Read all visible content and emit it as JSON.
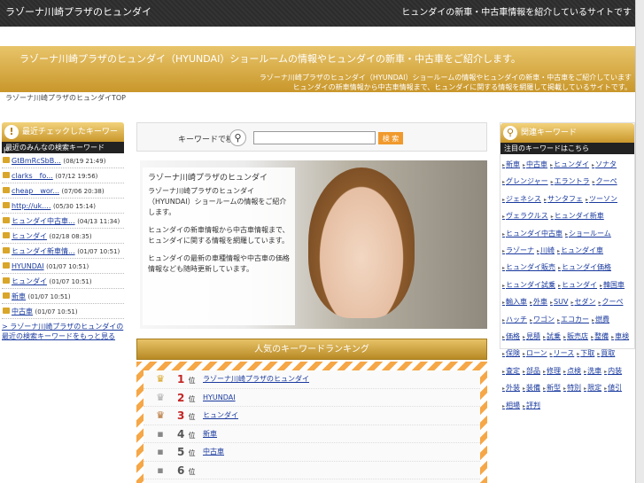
{
  "header": {
    "site_title": "ラゾーナ川崎プラザのヒュンダイ",
    "right_text": "ヒュンダイの新車・中古車情報を紹介しているサイトです"
  },
  "banner": {
    "title": "ラゾーナ川崎プラザのヒュンダイ（HYUNDAI）ショールームの情報やヒュンダイの新車・中古車をご紹介します。",
    "desc_line1": "ラゾーナ川崎プラザのヒュンダイ（HYUNDAI）ショールームの情報やヒュンダイの新車・中古車をご紹介しています",
    "desc_line2": "ヒュンダイの新車情報から中古車情報まで、ヒュンダイに関する情報を網羅して掲載しているサイトです。"
  },
  "breadcrumb": "ラゾーナ川崎プラザのヒュンダイTOP",
  "left": {
    "header": "最近チェックしたキーワード",
    "sub": "最近のみんなの検索キーワード",
    "items": [
      {
        "text": "GtBmRcSbB...",
        "date": "(08/19 21:49)"
      },
      {
        "text": "clarks　fo...",
        "date": "(07/12 19:56)"
      },
      {
        "text": "cheap　wor...",
        "date": "(07/06 20:38)"
      },
      {
        "text": "http://uk....",
        "date": "(05/30 15:14)"
      },
      {
        "text": "ヒュンダイ中古車...",
        "date": "(04/13 11:34)"
      },
      {
        "text": "ヒュンダイ",
        "date": "(02/18 08:35)"
      },
      {
        "text": "ヒュンダイ新車情...",
        "date": "(01/07 10:51)"
      },
      {
        "text": "HYUNDAI",
        "date": "(01/07 10:51)"
      },
      {
        "text": "ヒュンダイ",
        "date": "(01/07 10:51)"
      },
      {
        "text": "新車",
        "date": "(01/07 10:51)"
      },
      {
        "text": "中古車",
        "date": "(01/07 10:51)"
      }
    ],
    "more": "> ラゾーナ川崎プラザのヒュンダイの最近の検索キーワードをもっと見る"
  },
  "search": {
    "label": "キーワードで検索：",
    "value": "",
    "button": "検 索"
  },
  "hero": {
    "heading": "ラゾーナ川崎プラザのヒュンダイ",
    "p1": "ラゾーナ川崎プラザのヒュンダイ（HYUNDAI）ショールームの情報をご紹介します。",
    "p2": "ヒュンダイの新車情報から中古車情報まで、ヒュンダイに関する情報を網羅しています。",
    "p3": "ヒュンダイの最新の車種情報や中古車の価格情報なども随時更新しています。"
  },
  "ranking": {
    "title": "人気のキーワードランキング",
    "suffix": "位",
    "rows": [
      {
        "rank": "1",
        "keyword": "ラゾーナ川崎プラザのヒュンダイ"
      },
      {
        "rank": "2",
        "keyword": "HYUNDAI"
      },
      {
        "rank": "3",
        "keyword": "ヒュンダイ"
      },
      {
        "rank": "4",
        "keyword": "新車"
      },
      {
        "rank": "5",
        "keyword": "中古車"
      },
      {
        "rank": "6",
        "keyword": ""
      }
    ]
  },
  "right": {
    "header": "関連キーワード",
    "sub": "注目のキーワードはこちら",
    "tags": [
      "新車",
      "中古車",
      "ヒュンダイ",
      "ソナタ",
      "グレンジャー",
      "エラントラ",
      "クーペ",
      "ジェネシス",
      "サンタフェ",
      "ツーソン",
      "ヴェラクルス",
      "ヒュンダイ新車",
      "ヒュンダイ中古車",
      "ショールーム",
      "ラゾーナ",
      "川崎",
      "ヒュンダイ車",
      "ヒュンダイ販売",
      "ヒュンダイ価格",
      "ヒュンダイ試乗",
      "ヒュンダイ",
      "韓国車",
      "輸入車",
      "外車",
      "SUV",
      "セダン",
      "クーペ",
      "ハッチ",
      "ワゴン",
      "エコカー",
      "燃費",
      "価格",
      "見積",
      "試乗",
      "販売店",
      "整備",
      "車検",
      "保険",
      "ローン",
      "リース",
      "下取",
      "買取",
      "査定",
      "部品",
      "修理",
      "点検",
      "洗車",
      "内装",
      "外装",
      "装備",
      "新型",
      "特別",
      "限定",
      "値引",
      "相場",
      "評判"
    ]
  }
}
